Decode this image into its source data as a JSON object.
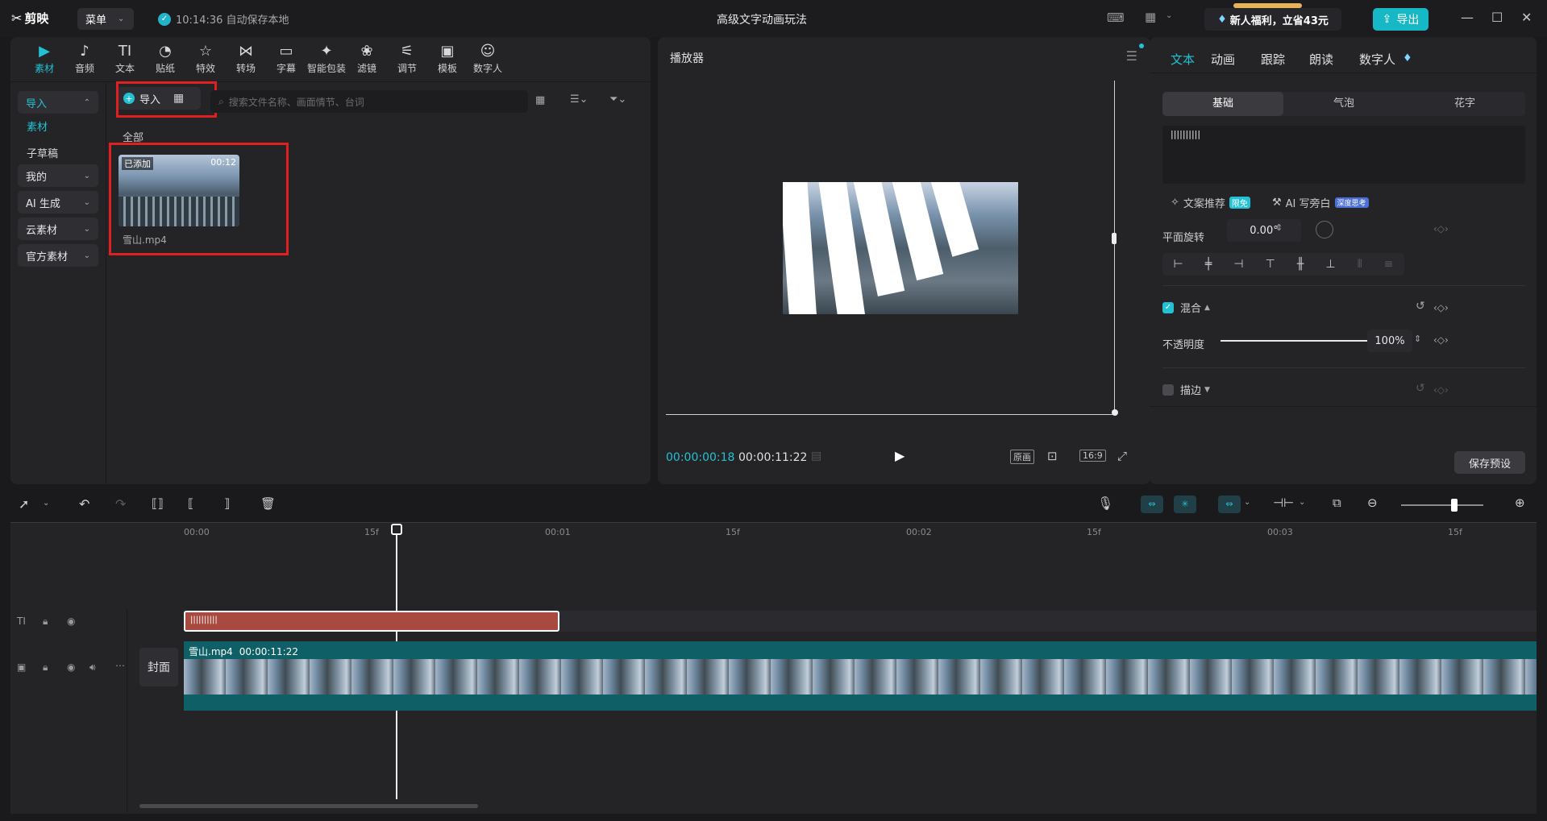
{
  "app": {
    "logo": "剪映",
    "menu": "菜单",
    "save_status": "10:14:36 自动保存本地",
    "title": "高级文字动画玩法",
    "promo": "新人福利，立省43元",
    "export": "导出"
  },
  "media_tools": [
    {
      "label": "素材",
      "icon": "▶"
    },
    {
      "label": "音频",
      "icon": "♪"
    },
    {
      "label": "文本",
      "icon": "TI"
    },
    {
      "label": "贴纸",
      "icon": "◔"
    },
    {
      "label": "特效",
      "icon": "☆"
    },
    {
      "label": "转场",
      "icon": "⋈"
    },
    {
      "label": "字幕",
      "icon": "▭"
    },
    {
      "label": "智能包装",
      "icon": "✦"
    },
    {
      "label": "滤镜",
      "icon": "❀"
    },
    {
      "label": "调节",
      "icon": "⚟"
    },
    {
      "label": "模板",
      "icon": "▣"
    },
    {
      "label": "数字人",
      "icon": "☺"
    }
  ],
  "media_side": {
    "import": "导入",
    "material": "素材",
    "subdraft": "子草稿",
    "mine": "我的",
    "ai_gen": "AI 生成",
    "cloud": "云素材",
    "official": "官方素材"
  },
  "media": {
    "import_btn": "导入",
    "search_placeholder": "搜索文件名称、画面情节、台词",
    "all_label": "全部",
    "clip_badge": "已添加",
    "clip_duration": "00:12",
    "clip_name": "雪山.mp4"
  },
  "player": {
    "title": "播放器",
    "current_time": "00:00:00:18",
    "total_time": "00:00:11:22",
    "original": "原画",
    "ratio": "16:9"
  },
  "props": {
    "tabs": [
      "文本",
      "动画",
      "跟踪",
      "朗读",
      "数字人"
    ],
    "segments": [
      "基础",
      "气泡",
      "花字"
    ],
    "text_value": "||||||||||",
    "copy_recommend": "文案推荐",
    "copy_badge": "限免",
    "ai_write": "AI 写旁白",
    "ai_badge": "深度思考",
    "rotate_label": "平面旋转",
    "rotate_value": "0.00°",
    "blend_label": "混合",
    "opacity_label": "不透明度",
    "opacity_value": "100%",
    "opacity_level": 1.0,
    "stroke_label": "描边",
    "save_preset": "保存预设"
  },
  "timeline": {
    "ruler_labels": [
      "00:00",
      "15f",
      "00:01",
      "15f",
      "00:02",
      "15f",
      "00:03",
      "15f"
    ],
    "text_clip": "||||||||||",
    "video_clip_name": "雪山.mp4",
    "video_clip_duration": "00:00:11:22",
    "cover": "封面"
  }
}
